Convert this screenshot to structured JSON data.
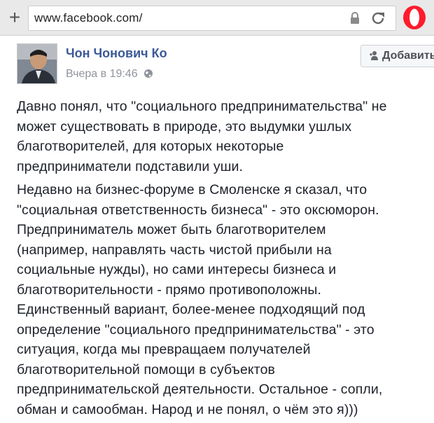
{
  "browser": {
    "new_tab_symbol": "+",
    "url": "www.facebook.com/",
    "icons": [
      "plus-icon",
      "lock-icon",
      "reload-icon",
      "opera-logo-icon"
    ]
  },
  "post": {
    "author": "Чон Чонович Ко",
    "timestamp": "Вчера в 19:46",
    "audience_icon": "globe-icon",
    "add_friend_label": "Добавить",
    "paragraph1_lines": [
      "Давно понял, что \"социального предпринимательства\" не",
      "может существовать в природе, это выдумки ушлых",
      "благотворителей, для которых некоторые",
      "предприниматели подставили уши."
    ],
    "paragraph2_lines": [
      "Недавно на бизнес-форуме в Смоленске я сказал, что",
      "\"социальная ответственность бизнеса\" - это оксюморон.",
      "Предприниматель может быть благотворителем",
      "(например, направлять часть чистой прибыли на",
      "социальные нужды), но сами интересы бизнеса и",
      "благотворительности - прямо противоположны.",
      "Единственный вариант, более-менее подходящий под",
      "определение \"социального предпринимательства\" - это",
      "ситуация, когда мы превращаем получателей",
      "благотворительной помощи в субъектов",
      "предпринимательской деятельности. Остальное - сопли,",
      "обман и самообман. Народ и не понял, о чём это я)))"
    ]
  },
  "colors": {
    "link": "#3b5998",
    "meta": "#90949c",
    "text": "#1d2129",
    "opera_red": "#ff1b2d"
  }
}
